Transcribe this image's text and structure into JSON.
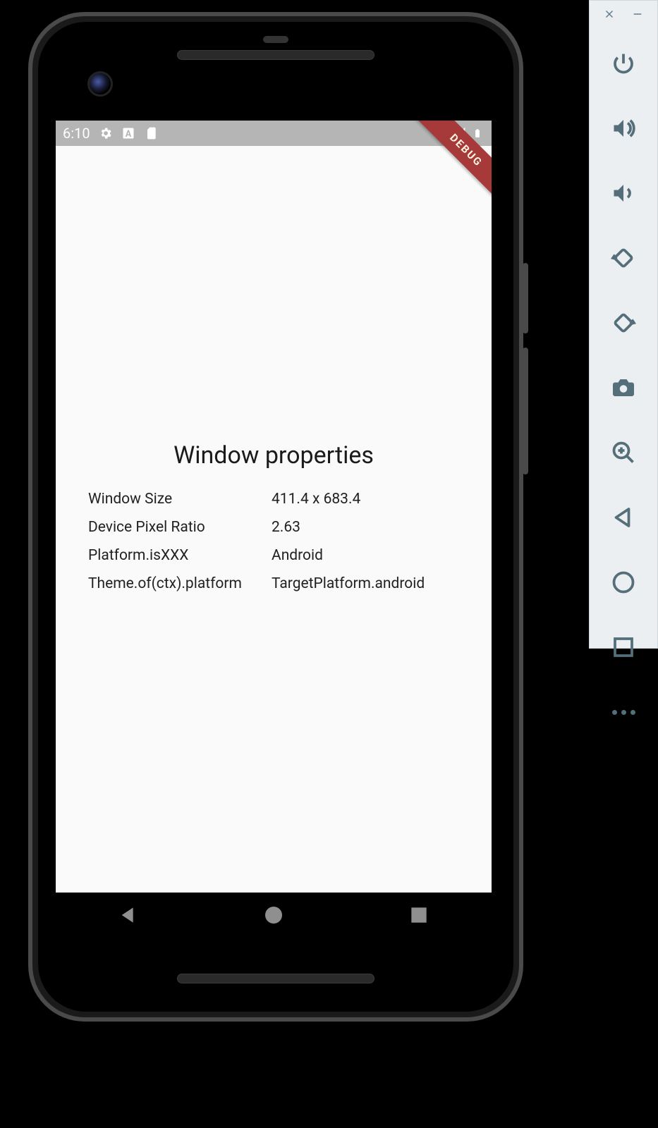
{
  "statusBar": {
    "time": "6:10",
    "icons_left": [
      "settings-icon",
      "letter-a-icon",
      "sdcard-icon"
    ],
    "icons_right": [
      "wifi-icon",
      "signal-icon",
      "battery-icon"
    ]
  },
  "debugBanner": "DEBUG",
  "app": {
    "title": "Window properties",
    "rows": [
      {
        "label": "Window Size",
        "value": "411.4 x 683.4"
      },
      {
        "label": "Device Pixel Ratio",
        "value": "2.63"
      },
      {
        "label": "Platform.isXXX",
        "value": "Android"
      },
      {
        "label": "Theme.of(ctx).platform",
        "value": "TargetPlatform.android"
      }
    ]
  },
  "navBar": [
    "back-icon",
    "home-icon",
    "recents-icon"
  ],
  "sidePanel": {
    "topButtons": [
      "close-icon",
      "minimize-icon"
    ],
    "buttons": [
      "power-icon",
      "volume-up-icon",
      "volume-down-icon",
      "rotate-left-icon",
      "rotate-right-icon",
      "camera-icon",
      "zoom-in-icon",
      "back-icon",
      "home-circle-icon",
      "overview-square-icon"
    ],
    "more": "more-icon"
  }
}
